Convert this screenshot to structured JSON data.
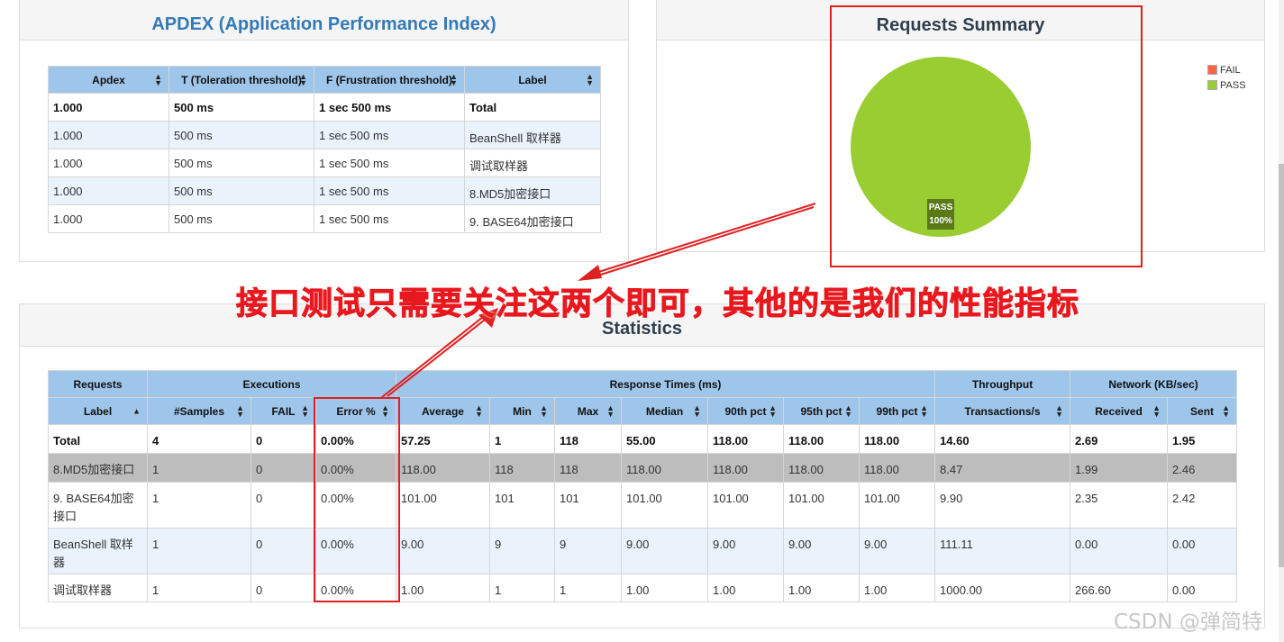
{
  "apdex": {
    "title": "APDEX (Application Performance Index)",
    "headers": [
      "Apdex",
      "T (Toleration threshold)",
      "F (Frustration threshold)",
      "Label"
    ],
    "rows": [
      {
        "apdex": "1.000",
        "t": "500 ms",
        "f": "1 sec 500 ms",
        "label": "Total"
      },
      {
        "apdex": "1.000",
        "t": "500 ms",
        "f": "1 sec 500 ms",
        "label": "BeanShell 取样器"
      },
      {
        "apdex": "1.000",
        "t": "500 ms",
        "f": "1 sec 500 ms",
        "label": "调试取样器"
      },
      {
        "apdex": "1.000",
        "t": "500 ms",
        "f": "1 sec 500 ms",
        "label": "8.MD5加密接口"
      },
      {
        "apdex": "1.000",
        "t": "500 ms",
        "f": "1 sec 500 ms",
        "label": "9. BASE64加密接口"
      }
    ]
  },
  "summary": {
    "title": "Requests Summary",
    "legend": [
      {
        "label": "FAIL",
        "color": "#ff6347"
      },
      {
        "label": "PASS",
        "color": "#9acd32"
      }
    ],
    "pie_label": "PASS",
    "pie_percent": "100%"
  },
  "chart_data": {
    "type": "pie",
    "title": "Requests Summary",
    "categories": [
      "FAIL",
      "PASS"
    ],
    "values": [
      0,
      100
    ],
    "colors": [
      "#ff6347",
      "#9acd32"
    ],
    "legend": "top-right"
  },
  "statistics": {
    "title": "Statistics",
    "groups": [
      "Requests",
      "Executions",
      "Response Times (ms)",
      "Throughput",
      "Network (KB/sec)"
    ],
    "headers": [
      "Label",
      "#Samples",
      "FAIL",
      "Error %",
      "Average",
      "Min",
      "Max",
      "Median",
      "90th pct",
      "95th pct",
      "99th pct",
      "Transactions/s",
      "Received",
      "Sent"
    ],
    "rows": [
      [
        "Total",
        "4",
        "0",
        "0.00%",
        "57.25",
        "1",
        "118",
        "55.00",
        "118.00",
        "118.00",
        "118.00",
        "14.60",
        "2.69",
        "1.95"
      ],
      [
        "8.MD5加密接口",
        "1",
        "0",
        "0.00%",
        "118.00",
        "118",
        "118",
        "118.00",
        "118.00",
        "118.00",
        "118.00",
        "8.47",
        "1.99",
        "2.46"
      ],
      [
        "9. BASE64加密接口",
        "1",
        "0",
        "0.00%",
        "101.00",
        "101",
        "101",
        "101.00",
        "101.00",
        "101.00",
        "101.00",
        "9.90",
        "2.35",
        "2.42"
      ],
      [
        "BeanShell 取样器",
        "1",
        "0",
        "0.00%",
        "9.00",
        "9",
        "9",
        "9.00",
        "9.00",
        "9.00",
        "9.00",
        "111.11",
        "0.00",
        "0.00"
      ],
      [
        "调试取样器",
        "1",
        "0",
        "0.00%",
        "1.00",
        "1",
        "1",
        "1.00",
        "1.00",
        "1.00",
        "1.00",
        "1000.00",
        "266.60",
        "0.00"
      ]
    ]
  },
  "annotation": "接口测试只需要关注这两个即可，其他的是我们的性能指标",
  "watermark": "CSDN @弹简特"
}
